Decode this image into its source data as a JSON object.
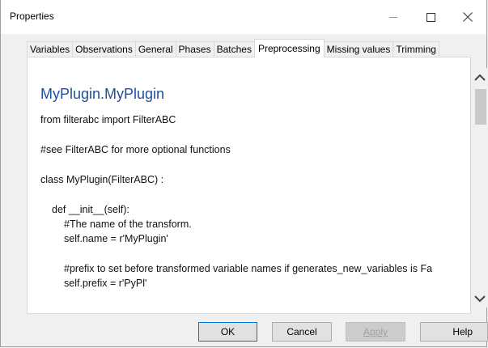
{
  "window": {
    "title": "Properties"
  },
  "tabs": [
    {
      "label": "Variables"
    },
    {
      "label": "Observations"
    },
    {
      "label": "General"
    },
    {
      "label": "Phases"
    },
    {
      "label": "Batches"
    },
    {
      "label": "Preprocessing",
      "active": true
    },
    {
      "label": "Missing values"
    },
    {
      "label": "Trimming"
    }
  ],
  "content": {
    "heading": "MyPlugin.MyPlugin",
    "lines": [
      "from filterabc import FilterABC",
      "#see FilterABC for more optional functions",
      "class MyPlugin(FilterABC) :",
      "def __init__(self):",
      "#The name of the transform.",
      "self.name = r'MyPlugin'",
      "#prefix to set before transformed variable names if generates_new_variables  is Fa",
      "self.prefix = r'PyPl'"
    ]
  },
  "buttons": {
    "ok": "OK",
    "cancel": "Cancel",
    "apply": "Apply",
    "help": "Help"
  },
  "icons": {
    "minimize": "minimize-icon",
    "maximize": "maximize-icon",
    "close": "close-icon",
    "scroll_up": "chevron-up-icon",
    "scroll_down": "chevron-down-icon"
  },
  "colors": {
    "heading": "#1f4e9e",
    "default_button_border": "#0078d7"
  }
}
